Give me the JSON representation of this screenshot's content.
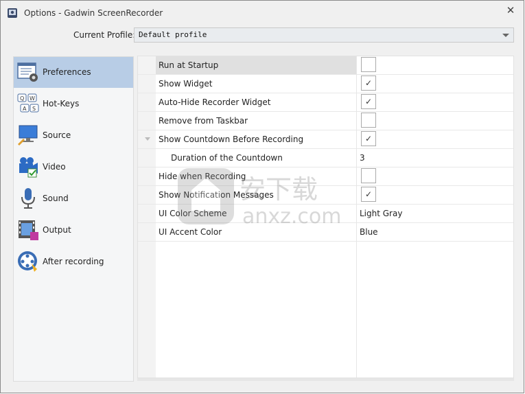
{
  "window": {
    "title": "Options - Gadwin ScreenRecorder",
    "close_icon": "close-icon"
  },
  "profile": {
    "label": "Current Profile:",
    "value": "Default profile"
  },
  "sidebar": {
    "items": [
      {
        "label": "Preferences",
        "icon": "preferences-icon",
        "selected": true
      },
      {
        "label": "Hot-Keys",
        "icon": "hotkeys-icon",
        "selected": false
      },
      {
        "label": "Source",
        "icon": "source-icon",
        "selected": false
      },
      {
        "label": "Video",
        "icon": "video-icon",
        "selected": false
      },
      {
        "label": "Sound",
        "icon": "microphone-icon",
        "selected": false
      },
      {
        "label": "Output",
        "icon": "output-icon",
        "selected": false
      },
      {
        "label": "After recording",
        "icon": "after-recording-icon",
        "selected": false
      }
    ]
  },
  "properties": {
    "rows": [
      {
        "name": "Run at Startup",
        "type": "checkbox",
        "checked": false,
        "selected": true
      },
      {
        "name": "Show Widget",
        "type": "checkbox",
        "checked": true
      },
      {
        "name": "Auto-Hide Recorder Widget",
        "type": "checkbox",
        "checked": true
      },
      {
        "name": "Remove from Taskbar",
        "type": "checkbox",
        "checked": false
      },
      {
        "name": "Show Countdown Before Recording",
        "type": "checkbox",
        "checked": true,
        "expandable": true
      },
      {
        "name": "Duration of the Countdown",
        "type": "text",
        "value": "3",
        "child": true
      },
      {
        "name": "Hide when Recording",
        "type": "checkbox",
        "checked": false
      },
      {
        "name": "Show Notification Messages",
        "type": "checkbox",
        "checked": true
      },
      {
        "name": "UI Color Scheme",
        "type": "text",
        "value": "Light Gray"
      },
      {
        "name": "UI Accent Color",
        "type": "text",
        "value": "Blue"
      }
    ],
    "check_mark": "✓"
  },
  "watermark": {
    "text_cn": "安下载",
    "text_en": "anxz.com"
  }
}
